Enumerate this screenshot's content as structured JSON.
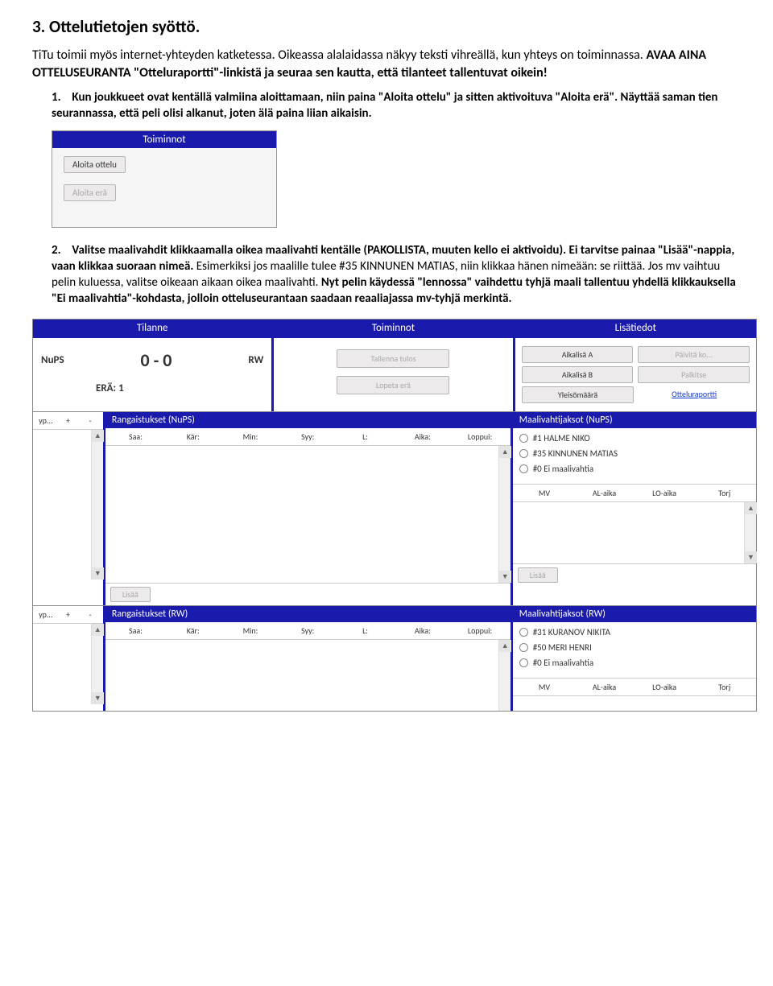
{
  "heading": "3. Ottelutietojen syöttö.",
  "intro_plain": "TiTu toimii myös internet-yhteyden katketessa. Oikeassa alalaidassa näkyy teksti vihreällä, kun yhteys on toiminnassa. ",
  "intro_bold": "AVAA AINA OTTELUSEURANTA \"Otteluraportti\"-linkistä ja seuraa sen kautta, että tilanteet tallentuvat oikein!",
  "item1_num": "1.",
  "item1_a": "Kun joukkueet ovat kentällä valmiina aloittamaan, niin paina \"Aloita ottelu\" ja sitten aktivoituva \"Aloita erä\". Näyttää saman tien seurannassa, että peli olisi alkanut, joten älä paina liian aikaisin.",
  "s1": {
    "header": "Toiminnot",
    "btn1": "Aloita ottelu",
    "btn2": "Aloita erä"
  },
  "item2_num": "2.",
  "item2_a": "Valitse maalivahdit klikkaamalla oikea maalivahti kentälle (PAKOLLISTA, muuten kello ei aktivoidu). ",
  "item2_b": "Ei tarvitse painaa \"Lisää\"-nappia, vaan klikkaa suoraan nimeä. ",
  "item2_c": "Esimerkiksi jos maalille tulee #35 KINNUNEN MATIAS, niin klikkaa hänen nimeään: se riittää. Jos mv vaihtuu pelin kuluessa, valitse oikeaan aikaan oikea maalivahti. ",
  "item2_d": "Nyt pelin käydessä \"lennossa\" vaihdettu tyhjä maali tallentuu yhdellä klikkauksella \"Ei maalivahtia\"-kohdasta, jolloin otteluseurantaan saadaan reaaliajassa mv-tyhjä merkintä.",
  "s2": {
    "header_tilanne": "Tilanne",
    "header_toiminnot": "Toiminnot",
    "header_lisatiedot": "Lisätiedot",
    "team1": "NuPS",
    "score": "0 - 0",
    "team2": "RW",
    "era": "ERÄ: 1",
    "btn_tallenna": "Tallenna tulos",
    "btn_lopeta": "Lopeta erä",
    "btn_aikalisa_a": "Aikalisä A",
    "btn_paivita": "Päivitä ko...",
    "btn_aikalisa_b": "Aikalisä B",
    "btn_palkitse": "Palkitse",
    "btn_yleiso": "Yleisömäärä",
    "link_raportti": "Otteluraportti",
    "narrow_h1": "yp...",
    "narrow_h2": "+",
    "narrow_h3": "-",
    "pen_nups": "Rangaistukset (NuPS)",
    "pen_rw": "Rangaistukset (RW)",
    "pen_h1": "Saa:",
    "pen_h2": "Kär:",
    "pen_h3": "Min:",
    "pen_h4": "Syy:",
    "pen_h5": "L:",
    "pen_h6": "Aika:",
    "pen_h7": "Loppui:",
    "gk_nups": "Maalivahtijaksot (NuPS)",
    "gk_rw": "Maalivahtijaksot (RW)",
    "gk_opt1": "#1 HALME NIKO",
    "gk_opt2": "#35 KINNUNEN MATIAS",
    "gk_opt3": "#0 Ei maalivahtia",
    "gk_rw_opt1": "#31 KURANOV NIKITA",
    "gk_rw_opt2": "#50 MERI HENRI",
    "gk_rw_opt3": "#0 Ei maalivahtia",
    "gk_h1": "MV",
    "gk_h2": "AL-aika",
    "gk_h3": "LO-aika",
    "gk_h4": "Torj",
    "btn_lisaa": "Lisää"
  }
}
